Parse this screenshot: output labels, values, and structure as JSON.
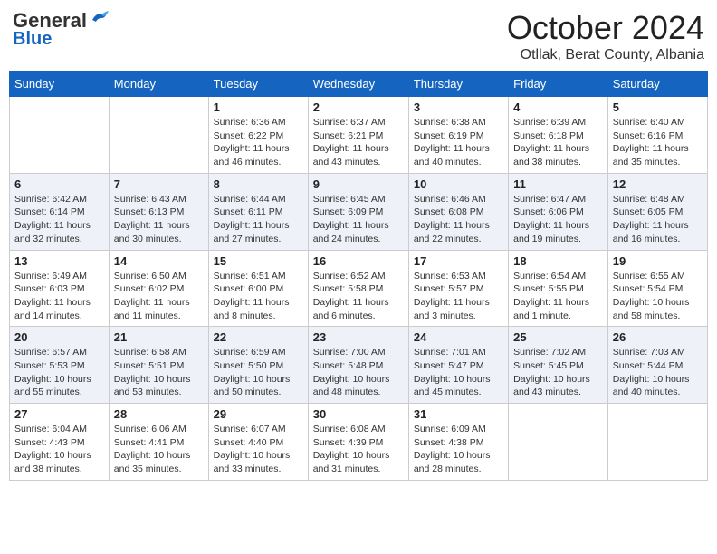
{
  "header": {
    "logo_general": "General",
    "logo_blue": "Blue",
    "month_title": "October 2024",
    "location": "Otllak, Berat County, Albania"
  },
  "days_of_week": [
    "Sunday",
    "Monday",
    "Tuesday",
    "Wednesday",
    "Thursday",
    "Friday",
    "Saturday"
  ],
  "weeks": [
    [
      {
        "day": "",
        "sunrise": "",
        "sunset": "",
        "daylight": ""
      },
      {
        "day": "",
        "sunrise": "",
        "sunset": "",
        "daylight": ""
      },
      {
        "day": "1",
        "sunrise": "Sunrise: 6:36 AM",
        "sunset": "Sunset: 6:22 PM",
        "daylight": "Daylight: 11 hours and 46 minutes."
      },
      {
        "day": "2",
        "sunrise": "Sunrise: 6:37 AM",
        "sunset": "Sunset: 6:21 PM",
        "daylight": "Daylight: 11 hours and 43 minutes."
      },
      {
        "day": "3",
        "sunrise": "Sunrise: 6:38 AM",
        "sunset": "Sunset: 6:19 PM",
        "daylight": "Daylight: 11 hours and 40 minutes."
      },
      {
        "day": "4",
        "sunrise": "Sunrise: 6:39 AM",
        "sunset": "Sunset: 6:18 PM",
        "daylight": "Daylight: 11 hours and 38 minutes."
      },
      {
        "day": "5",
        "sunrise": "Sunrise: 6:40 AM",
        "sunset": "Sunset: 6:16 PM",
        "daylight": "Daylight: 11 hours and 35 minutes."
      }
    ],
    [
      {
        "day": "6",
        "sunrise": "Sunrise: 6:42 AM",
        "sunset": "Sunset: 6:14 PM",
        "daylight": "Daylight: 11 hours and 32 minutes."
      },
      {
        "day": "7",
        "sunrise": "Sunrise: 6:43 AM",
        "sunset": "Sunset: 6:13 PM",
        "daylight": "Daylight: 11 hours and 30 minutes."
      },
      {
        "day": "8",
        "sunrise": "Sunrise: 6:44 AM",
        "sunset": "Sunset: 6:11 PM",
        "daylight": "Daylight: 11 hours and 27 minutes."
      },
      {
        "day": "9",
        "sunrise": "Sunrise: 6:45 AM",
        "sunset": "Sunset: 6:09 PM",
        "daylight": "Daylight: 11 hours and 24 minutes."
      },
      {
        "day": "10",
        "sunrise": "Sunrise: 6:46 AM",
        "sunset": "Sunset: 6:08 PM",
        "daylight": "Daylight: 11 hours and 22 minutes."
      },
      {
        "day": "11",
        "sunrise": "Sunrise: 6:47 AM",
        "sunset": "Sunset: 6:06 PM",
        "daylight": "Daylight: 11 hours and 19 minutes."
      },
      {
        "day": "12",
        "sunrise": "Sunrise: 6:48 AM",
        "sunset": "Sunset: 6:05 PM",
        "daylight": "Daylight: 11 hours and 16 minutes."
      }
    ],
    [
      {
        "day": "13",
        "sunrise": "Sunrise: 6:49 AM",
        "sunset": "Sunset: 6:03 PM",
        "daylight": "Daylight: 11 hours and 14 minutes."
      },
      {
        "day": "14",
        "sunrise": "Sunrise: 6:50 AM",
        "sunset": "Sunset: 6:02 PM",
        "daylight": "Daylight: 11 hours and 11 minutes."
      },
      {
        "day": "15",
        "sunrise": "Sunrise: 6:51 AM",
        "sunset": "Sunset: 6:00 PM",
        "daylight": "Daylight: 11 hours and 8 minutes."
      },
      {
        "day": "16",
        "sunrise": "Sunrise: 6:52 AM",
        "sunset": "Sunset: 5:58 PM",
        "daylight": "Daylight: 11 hours and 6 minutes."
      },
      {
        "day": "17",
        "sunrise": "Sunrise: 6:53 AM",
        "sunset": "Sunset: 5:57 PM",
        "daylight": "Daylight: 11 hours and 3 minutes."
      },
      {
        "day": "18",
        "sunrise": "Sunrise: 6:54 AM",
        "sunset": "Sunset: 5:55 PM",
        "daylight": "Daylight: 11 hours and 1 minute."
      },
      {
        "day": "19",
        "sunrise": "Sunrise: 6:55 AM",
        "sunset": "Sunset: 5:54 PM",
        "daylight": "Daylight: 10 hours and 58 minutes."
      }
    ],
    [
      {
        "day": "20",
        "sunrise": "Sunrise: 6:57 AM",
        "sunset": "Sunset: 5:53 PM",
        "daylight": "Daylight: 10 hours and 55 minutes."
      },
      {
        "day": "21",
        "sunrise": "Sunrise: 6:58 AM",
        "sunset": "Sunset: 5:51 PM",
        "daylight": "Daylight: 10 hours and 53 minutes."
      },
      {
        "day": "22",
        "sunrise": "Sunrise: 6:59 AM",
        "sunset": "Sunset: 5:50 PM",
        "daylight": "Daylight: 10 hours and 50 minutes."
      },
      {
        "day": "23",
        "sunrise": "Sunrise: 7:00 AM",
        "sunset": "Sunset: 5:48 PM",
        "daylight": "Daylight: 10 hours and 48 minutes."
      },
      {
        "day": "24",
        "sunrise": "Sunrise: 7:01 AM",
        "sunset": "Sunset: 5:47 PM",
        "daylight": "Daylight: 10 hours and 45 minutes."
      },
      {
        "day": "25",
        "sunrise": "Sunrise: 7:02 AM",
        "sunset": "Sunset: 5:45 PM",
        "daylight": "Daylight: 10 hours and 43 minutes."
      },
      {
        "day": "26",
        "sunrise": "Sunrise: 7:03 AM",
        "sunset": "Sunset: 5:44 PM",
        "daylight": "Daylight: 10 hours and 40 minutes."
      }
    ],
    [
      {
        "day": "27",
        "sunrise": "Sunrise: 6:04 AM",
        "sunset": "Sunset: 4:43 PM",
        "daylight": "Daylight: 10 hours and 38 minutes."
      },
      {
        "day": "28",
        "sunrise": "Sunrise: 6:06 AM",
        "sunset": "Sunset: 4:41 PM",
        "daylight": "Daylight: 10 hours and 35 minutes."
      },
      {
        "day": "29",
        "sunrise": "Sunrise: 6:07 AM",
        "sunset": "Sunset: 4:40 PM",
        "daylight": "Daylight: 10 hours and 33 minutes."
      },
      {
        "day": "30",
        "sunrise": "Sunrise: 6:08 AM",
        "sunset": "Sunset: 4:39 PM",
        "daylight": "Daylight: 10 hours and 31 minutes."
      },
      {
        "day": "31",
        "sunrise": "Sunrise: 6:09 AM",
        "sunset": "Sunset: 4:38 PM",
        "daylight": "Daylight: 10 hours and 28 minutes."
      },
      {
        "day": "",
        "sunrise": "",
        "sunset": "",
        "daylight": ""
      },
      {
        "day": "",
        "sunrise": "",
        "sunset": "",
        "daylight": ""
      }
    ]
  ]
}
